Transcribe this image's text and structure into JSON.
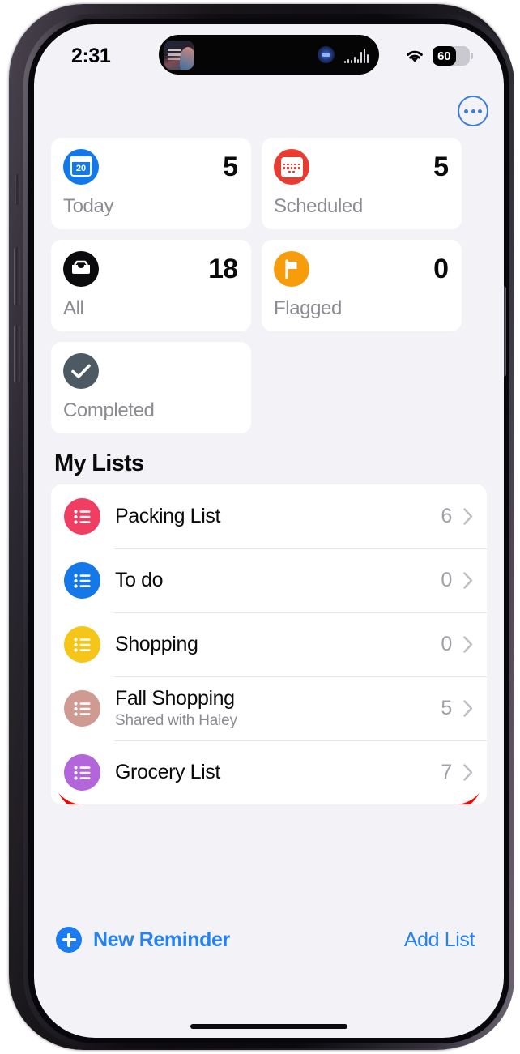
{
  "status_bar": {
    "time": "2:31",
    "wifi_icon": "wifi-icon",
    "battery_level": "60",
    "battery_percent": 60,
    "dynamic_island": {
      "media_art_icon": "album-art-icon",
      "siri_orb_icon": "siri-orb-icon",
      "waveform_icon": "audio-waveform-icon"
    }
  },
  "navbar": {
    "more_options_icon": "more-options-icon"
  },
  "smart_lists": [
    {
      "label": "Today",
      "count": "5",
      "icon": "today-calendar-icon",
      "icon_color": "#1578e8",
      "day": "20"
    },
    {
      "label": "Scheduled",
      "count": "5",
      "icon": "scheduled-calendar-icon",
      "icon_color": "#ea3b30"
    },
    {
      "label": "All",
      "count": "18",
      "icon": "all-tray-icon",
      "icon_color": "#0b0b0d"
    },
    {
      "label": "Flagged",
      "count": "0",
      "icon": "flag-icon",
      "icon_color": "#f79d0c"
    },
    {
      "label": "Completed",
      "count": "",
      "icon": "completed-check-icon",
      "icon_color": "#4d5a63"
    }
  ],
  "my_lists": {
    "title": "My Lists",
    "items": [
      {
        "name": "Packing List",
        "subtitle": "",
        "count": "6",
        "icon": "list-bullets-icon",
        "icon_color": "#f03e63",
        "highlighted": false
      },
      {
        "name": "To do",
        "subtitle": "",
        "count": "0",
        "icon": "list-bullets-icon",
        "icon_color": "#1578e8",
        "highlighted": false
      },
      {
        "name": "Shopping",
        "subtitle": "",
        "count": "0",
        "icon": "list-bullets-icon",
        "icon_color": "#f5c518",
        "highlighted": false
      },
      {
        "name": "Fall Shopping",
        "subtitle": "Shared with Haley",
        "count": "5",
        "icon": "list-bullets-icon",
        "icon_color": "#cf9a92",
        "highlighted": false
      },
      {
        "name": "Grocery List",
        "subtitle": "",
        "count": "7",
        "icon": "list-bullets-icon",
        "icon_color": "#b266d9",
        "highlighted": true
      }
    ]
  },
  "toolbar": {
    "new_reminder_label": "New Reminder",
    "new_reminder_icon": "plus-circle-icon",
    "add_list_label": "Add List"
  },
  "annotation": {
    "type": "rounded-rectangle-highlight",
    "color": "#ff0000",
    "targets": "Grocery List"
  }
}
